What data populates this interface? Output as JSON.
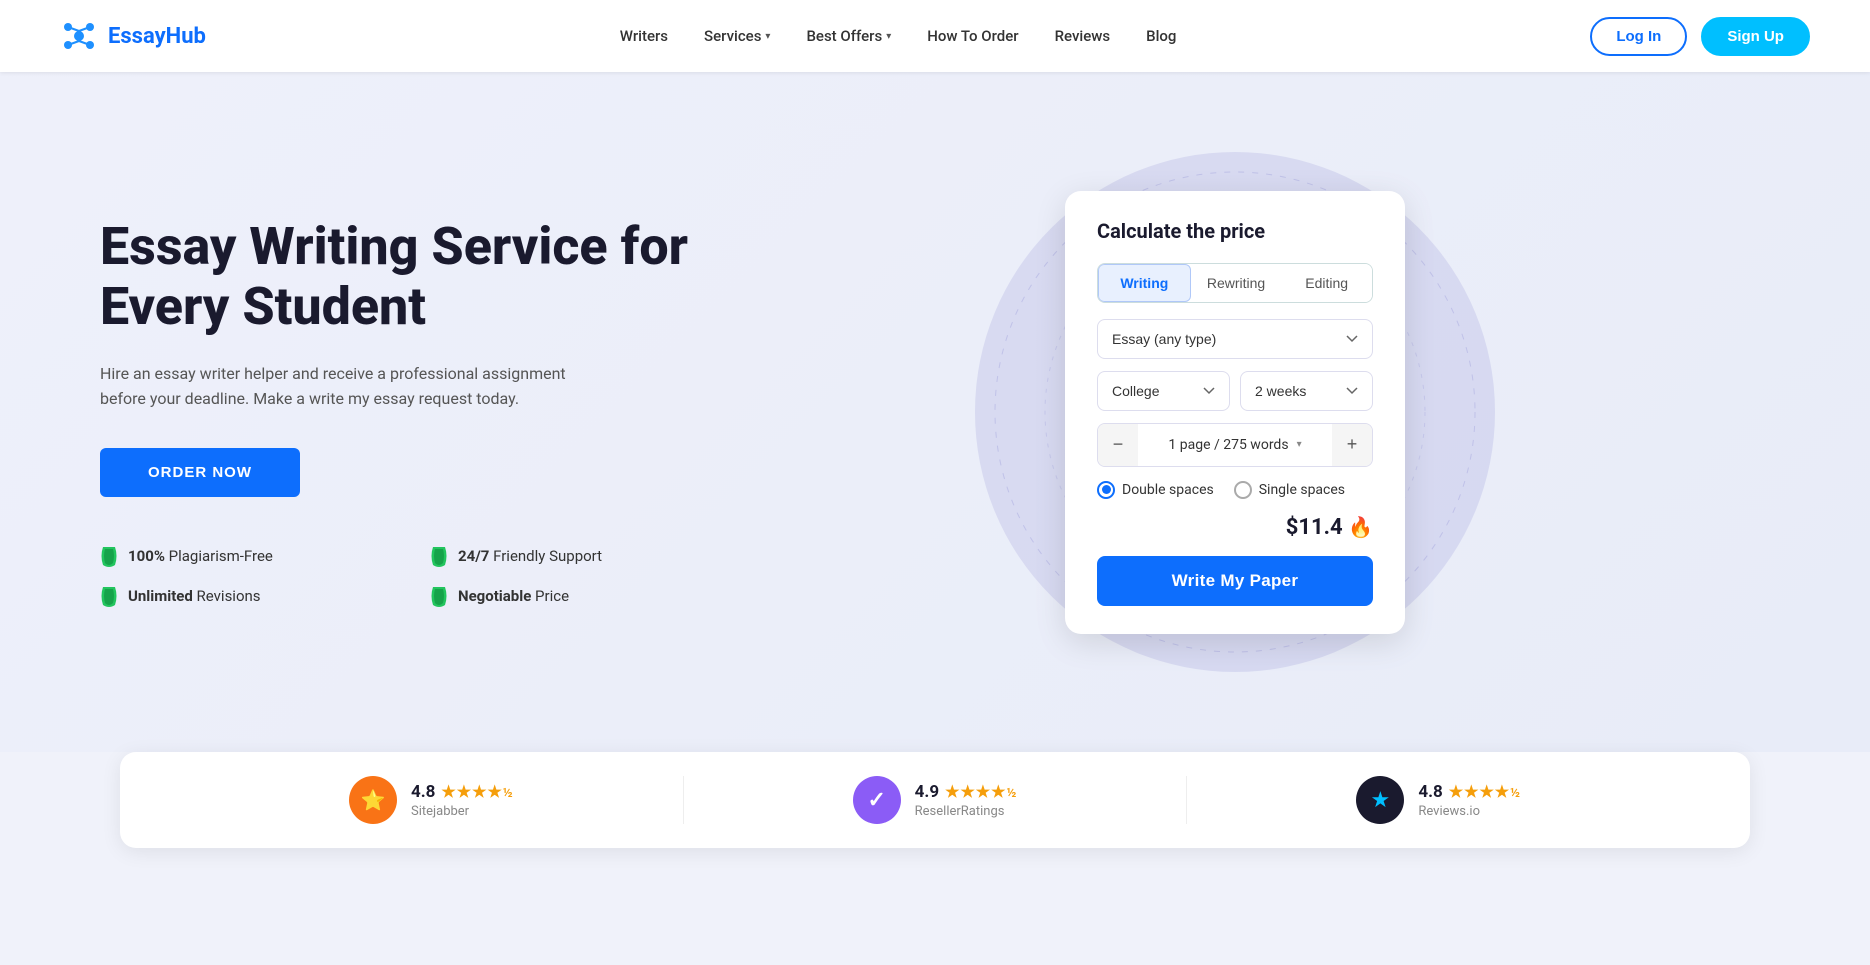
{
  "header": {
    "logo_text_essay": "Essay",
    "logo_text_hub": "Hub",
    "nav_items": [
      {
        "label": "Writers",
        "has_chevron": false
      },
      {
        "label": "Services",
        "has_chevron": true
      },
      {
        "label": "Best Offers",
        "has_chevron": true
      },
      {
        "label": "How To Order",
        "has_chevron": false
      },
      {
        "label": "Reviews",
        "has_chevron": false
      },
      {
        "label": "Blog",
        "has_chevron": false
      }
    ],
    "login_label": "Log In",
    "signup_label": "Sign Up"
  },
  "hero": {
    "title": "Essay Writing Service for Every Student",
    "subtitle": "Hire an essay writer helper and receive a professional assignment before your deadline. Make a write my essay request today.",
    "order_button": "ORDER NOW",
    "features": [
      {
        "bold": "100%",
        "text": " Plagiarism-Free"
      },
      {
        "bold": "24/7",
        "text": " Friendly Support"
      },
      {
        "bold": "Unlimited",
        "text": " Revisions"
      },
      {
        "bold": "Negotiable",
        "text": " Price"
      }
    ]
  },
  "calculator": {
    "title": "Calculate the price",
    "tabs": [
      {
        "label": "Writing",
        "active": true
      },
      {
        "label": "Rewriting",
        "active": false
      },
      {
        "label": "Editing",
        "active": false
      }
    ],
    "paper_type_placeholder": "Essay (any type)",
    "academic_level_placeholder": "College",
    "deadline_placeholder": "2 weeks",
    "pages_value": "1 page / 275 words",
    "spacing_options": [
      {
        "label": "Double spaces",
        "selected": true
      },
      {
        "label": "Single spaces",
        "selected": false
      }
    ],
    "price": "$11.4",
    "write_button": "Write My Paper"
  },
  "ratings": [
    {
      "score": "4.8",
      "stars": "★★★★",
      "half_star": "½",
      "source": "Sitejabber",
      "badge_color": "#f97316",
      "badge_icon": "⭐"
    },
    {
      "score": "4.9",
      "stars": "★★★★",
      "half_star": "½",
      "source": "ResellerRatings",
      "badge_color": "#8b5cf6",
      "badge_icon": "✓"
    },
    {
      "score": "4.8",
      "stars": "★★★★",
      "half_star": "½",
      "source": "Reviews.io",
      "badge_color": "#1a1a2e",
      "badge_icon": "★"
    }
  ]
}
